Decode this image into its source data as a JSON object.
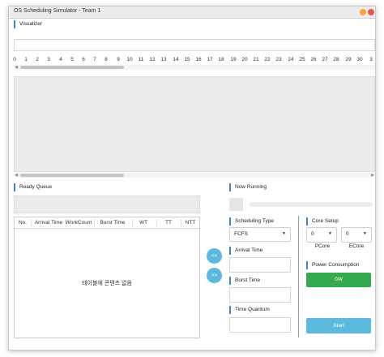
{
  "window": {
    "title": "OS Scheduling Simulator - Team 1"
  },
  "visualizer": {
    "label": "Visualizer",
    "ticks": [
      "0",
      "1",
      "2",
      "3",
      "4",
      "5",
      "6",
      "7",
      "8",
      "9",
      "10",
      "11",
      "12",
      "13",
      "14",
      "15",
      "16",
      "17",
      "18",
      "19",
      "20",
      "21",
      "22",
      "23",
      "24",
      "25",
      "26",
      "27",
      "28",
      "29",
      "30",
      "3"
    ]
  },
  "ready_queue": {
    "label": "Ready Queue",
    "columns": [
      "No.",
      "Arrival Time",
      "WorkCount",
      "Burst Time",
      "WT",
      "TT",
      "NTT"
    ],
    "empty_message": "테이블에 콘텐츠 없음"
  },
  "controls": {
    "prev_label": "<<",
    "next_label": ">>"
  },
  "now_running": {
    "label": "Now Running",
    "progress": 0
  },
  "scheduling": {
    "label": "Scheduling Type",
    "selected": "FCFS",
    "arrival_label": "Arrival Time",
    "arrival_value": "",
    "burst_label": "Burst Time",
    "burst_value": "",
    "quantum_label": "Time Quantum",
    "quantum_value": ""
  },
  "core_setup": {
    "label": "Core Setup",
    "pcore_value": "0",
    "pcore_label": "PCore",
    "ecore_value": "0",
    "ecore_label": "ECore"
  },
  "power": {
    "label": "Power Consumption",
    "value": "0W"
  },
  "start_label": "Start",
  "colors": {
    "accent": "#3a86c8",
    "primary_button": "#5ab9dc",
    "power_button": "#35a94f"
  },
  "icons": {
    "caret": "chevron-down-icon",
    "scroll_left": "arrow-left-icon",
    "scroll_right": "arrow-right-icon"
  }
}
